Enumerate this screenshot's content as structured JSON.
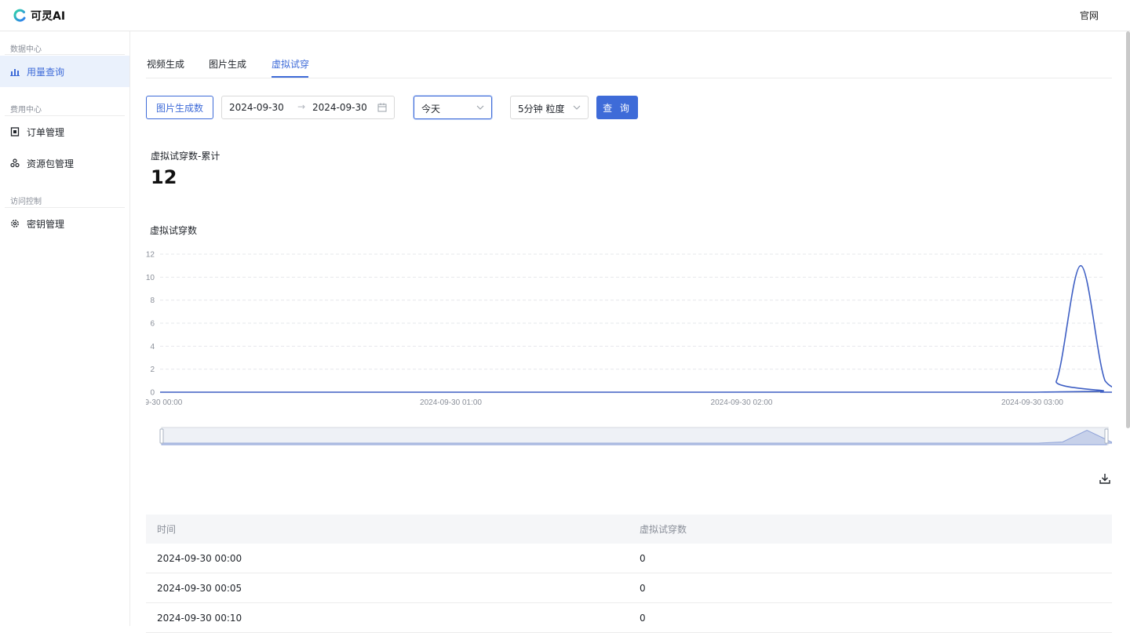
{
  "app": {
    "name": "可灵AI",
    "official_link": "官网"
  },
  "sidebar": {
    "groups": [
      {
        "title": "数据中心",
        "items": [
          {
            "label": "用量查询",
            "icon": "bar-chart-icon",
            "active": true
          }
        ]
      },
      {
        "title": "费用中心",
        "items": [
          {
            "label": "订单管理",
            "icon": "order-icon"
          },
          {
            "label": "资源包管理",
            "icon": "package-icon"
          }
        ]
      },
      {
        "title": "访问控制",
        "items": [
          {
            "label": "密钥管理",
            "icon": "key-gear-icon"
          }
        ]
      }
    ]
  },
  "tabs": [
    {
      "label": "视频生成"
    },
    {
      "label": "图片生成"
    },
    {
      "label": "虚拟试穿",
      "active": true
    }
  ],
  "filters": {
    "metric_button": "图片生成数",
    "date_start": "2024-09-30",
    "date_end": "2024-09-30",
    "range_select": "今天",
    "granularity_select": "5分钟 粒度",
    "query_button": "查 询"
  },
  "stat": {
    "label": "虚拟试穿数-累计",
    "value": "12"
  },
  "chart_data": {
    "type": "area",
    "title": "虚拟试穿数",
    "x_tick_labels": [
      "-09-30 00:00",
      "2024-09-30 01:00",
      "2024-09-30 02:00",
      "2024-09-30 03:00"
    ],
    "y_ticks": [
      0,
      2,
      4,
      6,
      8,
      10,
      12
    ],
    "ylim": [
      0,
      12
    ],
    "grid": true,
    "color": "#3e5fc4",
    "series": [
      {
        "x": [
          "00:00",
          "03:00",
          "03:05",
          "03:10",
          "03:15",
          "03:20",
          "03:25"
        ],
        "values": [
          0,
          0,
          1,
          11,
          1,
          0,
          0
        ]
      }
    ]
  },
  "table": {
    "headers": [
      "时间",
      "虚拟试穿数"
    ],
    "rows": [
      [
        "2024-09-30 00:00",
        "0"
      ],
      [
        "2024-09-30 00:05",
        "0"
      ],
      [
        "2024-09-30 00:10",
        "0"
      ]
    ]
  }
}
